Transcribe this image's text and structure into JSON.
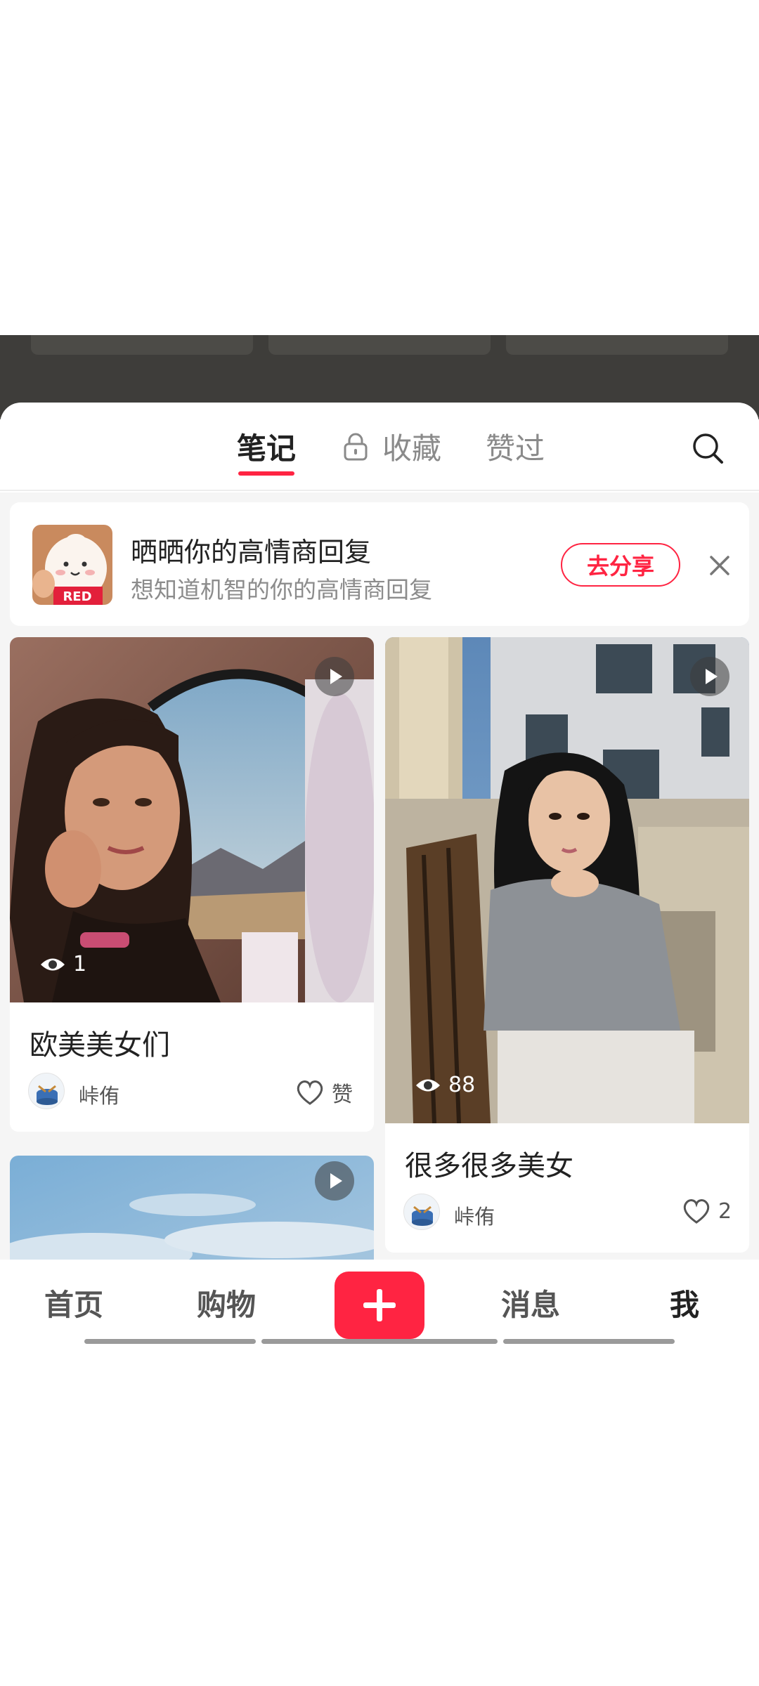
{
  "tabs": {
    "notes": "笔记",
    "collections": "收藏",
    "likes": "赞过"
  },
  "banner": {
    "title": "晒晒你的高情商回复",
    "subtitle": "想知道机智的你的高情商回复",
    "action": "去分享",
    "thumb_text": "RED"
  },
  "cards": [
    {
      "title": "欧美美女们",
      "views": "1",
      "author": "峠侑",
      "like_label": "赞"
    },
    {
      "title": "很多很多美女",
      "views": "88",
      "author": "峠侑",
      "like_label": "2"
    }
  ],
  "nav": {
    "home": "首页",
    "shop": "购物",
    "messages": "消息",
    "me": "我"
  },
  "colors": {
    "accent": "#ff2442",
    "dark_bg": "#3e3d3a"
  }
}
